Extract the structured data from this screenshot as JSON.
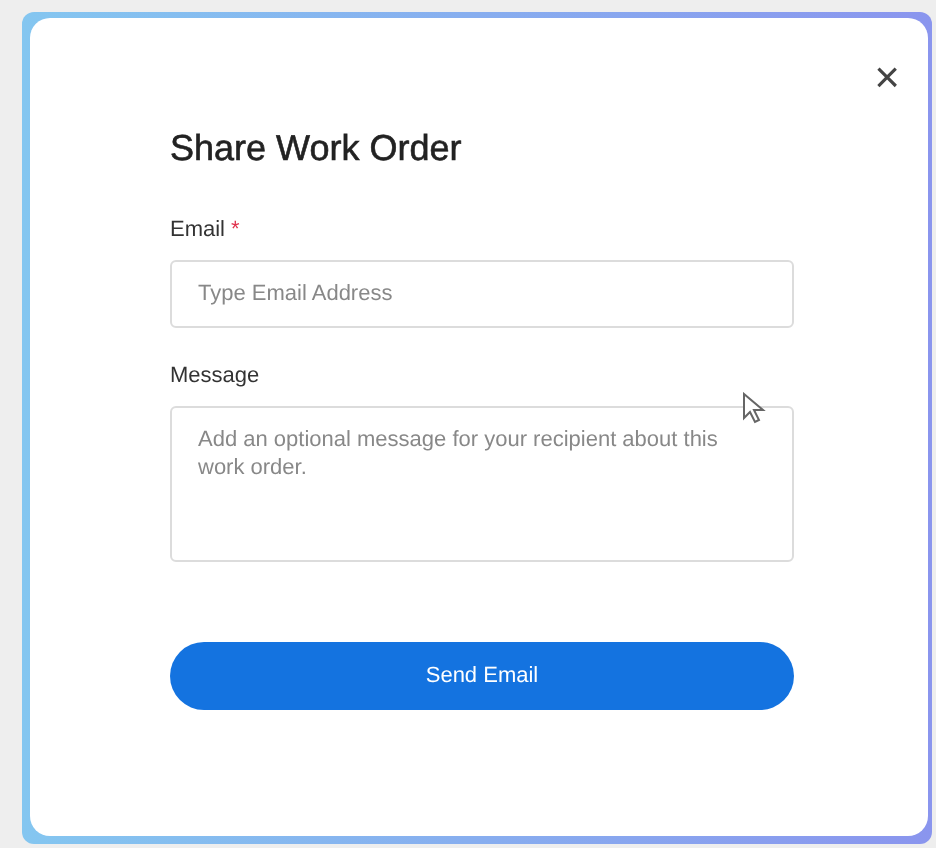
{
  "dialog": {
    "close_glyph": "×",
    "title": "Share Work Order"
  },
  "fields": [
    {
      "kind": "input",
      "label": "Email",
      "required_mark": "*",
      "placeholder": "Type Email Address"
    },
    {
      "kind": "textarea",
      "label": "Message",
      "placeholder": "Add an optional message for your recipient about this work order."
    }
  ],
  "buttons": [
    "Send Email"
  ]
}
